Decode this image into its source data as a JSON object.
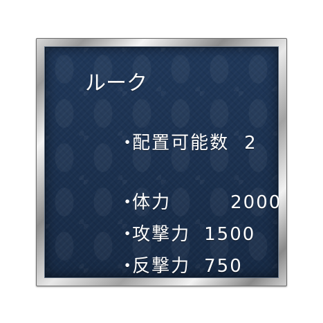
{
  "card": {
    "title": "ルーク",
    "bullet": "・",
    "stats": [
      {
        "label": "配置可能数",
        "value": "2"
      },
      {
        "label": "体力",
        "value": "2000"
      },
      {
        "label": "攻撃力",
        "value": "1500"
      },
      {
        "label": "反撃力",
        "value": "750"
      }
    ]
  },
  "colors": {
    "panel": "#1b304d",
    "frame": "#c0c0c0",
    "text": "#ffffff"
  }
}
